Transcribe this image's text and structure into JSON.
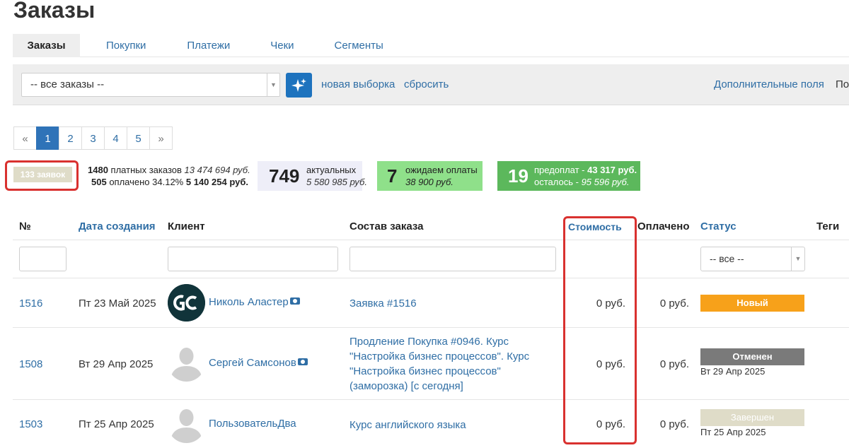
{
  "page": {
    "title": "Заказы"
  },
  "tabs": [
    {
      "label": "Заказы",
      "active": true
    },
    {
      "label": "Покупки"
    },
    {
      "label": "Платежи"
    },
    {
      "label": "Чеки"
    },
    {
      "label": "Сегменты"
    }
  ],
  "filterbar": {
    "select_value": "-- все заказы --",
    "magic_icon": "sparkles-icon",
    "new_selection": "новая выборка",
    "reset": "сбросить",
    "extra_fields": "Дополнительные поля",
    "cut_label": "По"
  },
  "pagination": {
    "prev": "«",
    "pages": [
      "1",
      "2",
      "3",
      "4",
      "5"
    ],
    "next": "»",
    "current": "1"
  },
  "stats": {
    "requests": "133 заявок",
    "paid_count": "1480",
    "paid_label": "платных заказов",
    "paid_sum": "13 474 694 руб.",
    "paid_done_count": "505",
    "paid_done_label": "оплачено 34.12%",
    "paid_done_sum": "5 140 254 руб.",
    "actual_count": "749",
    "actual_label": "актуальных",
    "actual_sum": "5 580 985 руб.",
    "waiting_count": "7",
    "waiting_label": "ожидаем оплаты",
    "waiting_sum": "38 900 руб.",
    "prepay_count": "19",
    "prepay_label": "предоплат -",
    "prepay_sum": "43 317 руб.",
    "remaining_label": "осталось -",
    "remaining_sum": "95 596 руб."
  },
  "table": {
    "headers": {
      "num": "№",
      "created": "Дата создания",
      "client": "Клиент",
      "composition": "Состав заказа",
      "cost": "Стоимость",
      "paid": "Оплачено",
      "status": "Статус",
      "tags": "Теги"
    },
    "status_filter": "-- все --",
    "rows": [
      {
        "num": "1516",
        "date": "Пт 23 Май 2025",
        "client": "Николь Аластер",
        "avatar": "gc-logo",
        "composition": [
          "Заявка #1516"
        ],
        "cost": "0 руб.",
        "paid": "0 руб.",
        "status": "Новый",
        "status_color": "#f7a11a",
        "status_date": ""
      },
      {
        "num": "1508",
        "date": "Вт 29 Апр 2025",
        "client": "Сергей Самсонов",
        "avatar": "person-placeholder",
        "composition": [
          "Продление Покупка #0946. Курс",
          "\"Настройка бизнес процессов\". Курс",
          "\"Настройка бизнес процессов\"",
          "(заморозка) [с сегодня]"
        ],
        "cost": "0 руб.",
        "paid": "0 руб.",
        "status": "Отменен",
        "status_color": "#7a7a7a",
        "status_date": "Вт 29 Апр 2025"
      },
      {
        "num": "1503",
        "date": "Пт 25 Апр 2025",
        "client": "ПользовательДва",
        "avatar": "person-placeholder",
        "composition": [
          "Курс английского языка"
        ],
        "cost": "0 руб.",
        "paid": "0 руб.",
        "status": "Завершен",
        "status_color": "#dfdcc8",
        "status_date": "Пт 25 Апр 2025"
      }
    ]
  },
  "colors": {
    "accent": "#2f6ea5",
    "primary_button": "#1e73be",
    "highlight_outline": "#d9312f",
    "waiting_card": "#8fe08a",
    "prepay_card": "#5cb85c",
    "actual_card": "#eeeef8"
  }
}
